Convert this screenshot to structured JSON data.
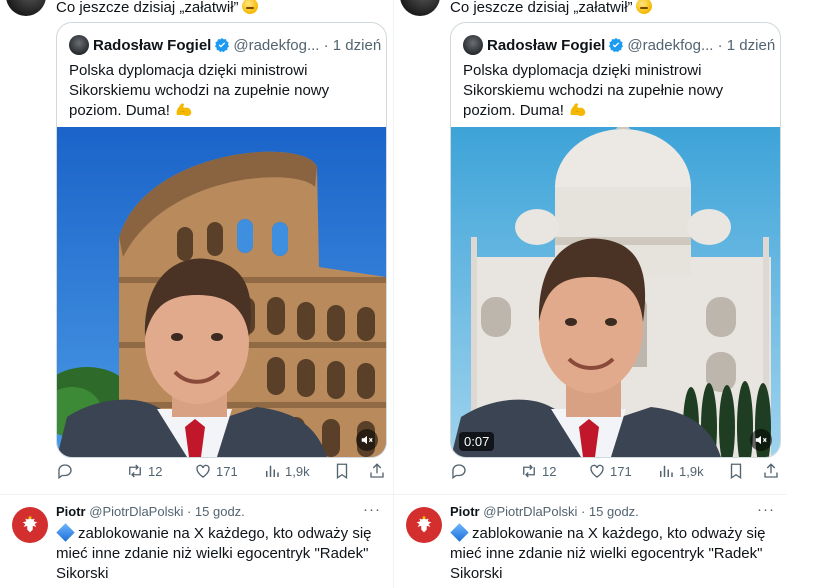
{
  "panels": [
    {
      "top_text": "Co jeszcze dzisiaj „załatwił”",
      "quote": {
        "name": "Radosław Fogiel",
        "handle_time": "@radekfog... · 1 dzień",
        "text": "Polska dyplomacja dzięki ministrowi Sikorskiemu wchodzi na zupełnie nowy poziom. Duma!",
        "media_scene": "colosseum",
        "duration": ""
      },
      "actions": {
        "retweets": "12",
        "likes": "171",
        "views": "1,9k"
      },
      "reply": {
        "name": "Piotr",
        "handle_time": "@PiotrDlaPolski · 15 godz.",
        "text": "zablokowanie na X każdego, kto odważy się mieć inne zdanie niż wielki egocentryk \"Radek\" Sikorski"
      }
    },
    {
      "top_text": "Co jeszcze dzisiaj „załatwił”",
      "quote": {
        "name": "Radosław Fogiel",
        "handle_time": "@radekfog... · 1 dzień",
        "text": "Polska dyplomacja dzięki ministrowi Sikorskiemu wchodzi na zupełnie nowy poziom. Duma!",
        "media_scene": "taj-mahal",
        "duration": "0:07"
      },
      "actions": {
        "retweets": "12",
        "likes": "171",
        "views": "1,9k"
      },
      "reply": {
        "name": "Piotr",
        "handle_time": "@PiotrDlaPolski · 15 godz.",
        "text": "zablokowanie na X każdego, kto odważy się mieć inne zdanie niż wielki egocentryk \"Radek\" Sikorski"
      }
    }
  ],
  "icons": {
    "verified": "verified-badge-icon",
    "reply": "reply-icon",
    "retweet": "retweet-icon",
    "like": "heart-icon",
    "views": "views-icon",
    "bookmark": "bookmark-icon",
    "share": "share-icon",
    "more": "more-icon",
    "mute": "speaker-muted-icon"
  },
  "colors": {
    "verified": "#1d9bf0",
    "secondary_text": "#536471",
    "border": "#cfd9de"
  }
}
